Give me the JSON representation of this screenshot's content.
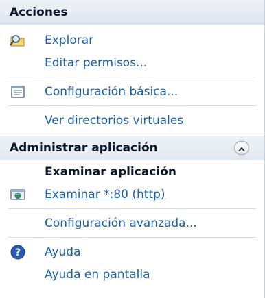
{
  "header": {
    "title": "Acciones"
  },
  "actions": {
    "explore": "Explorar",
    "edit_permissions": "Editar permisos...",
    "basic_settings": "Configuración básica...",
    "view_virtual_dirs": "Ver directorios virtuales"
  },
  "manage_app": {
    "title": "Administrar aplicación",
    "browse_heading": "Examinar aplicación",
    "browse_link": "Examinar *:80 (http)",
    "advanced_settings": "Configuración avanzada..."
  },
  "help": {
    "help": "Ayuda",
    "online_help": "Ayuda en pantalla"
  },
  "colors": {
    "link": "#1a5fa8",
    "heading_bg": "#e2e8ef",
    "help_icon": "#2a5db0"
  },
  "icons": {
    "explore": "folder-search-icon",
    "basic_settings": "settings-window-icon",
    "browse": "browser-globe-icon",
    "collapse": "chevron-up-icon",
    "help": "help-question-icon"
  }
}
